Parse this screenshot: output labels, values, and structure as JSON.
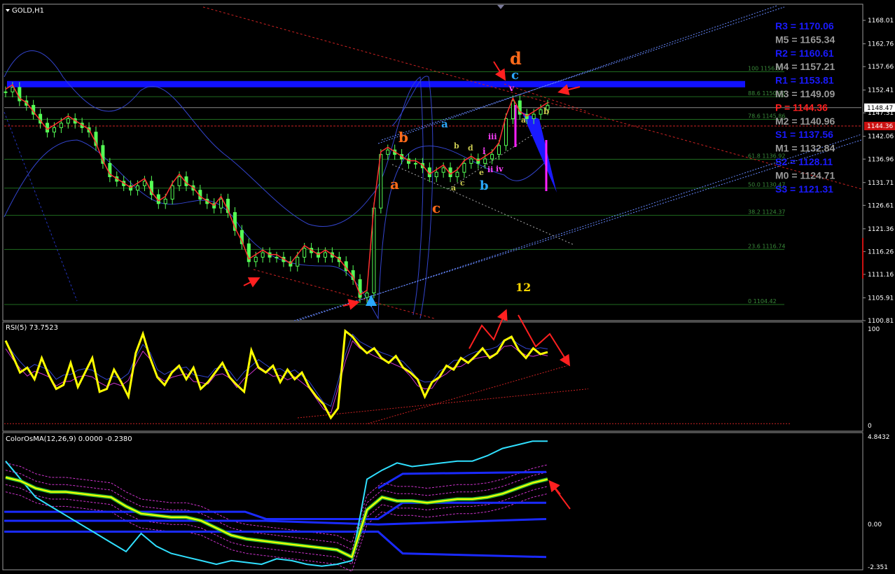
{
  "chart_data": [
    {
      "type": "candlestick",
      "title": "GOLD,H1",
      "ylim": [
        1100.81,
        1171.0
      ],
      "y_ticks": [
        "1168.01",
        "1162.76",
        "1157.66",
        "1152.41",
        "1147.31",
        "1142.06",
        "1136.96",
        "1131.71",
        "1126.61",
        "1121.36",
        "1116.26",
        "1111.16",
        "1105.91",
        "1100.81"
      ],
      "current_price_tag": "1148.47",
      "pivot_price_tag": "1144.36",
      "close_path": [
        1152,
        1153,
        1150,
        1149,
        1147,
        1145,
        1143,
        1144,
        1145,
        1146,
        1145,
        1144,
        1143,
        1140,
        1136,
        1133,
        1132,
        1131,
        1130,
        1131,
        1132,
        1129,
        1127,
        1128,
        1131,
        1133,
        1131,
        1130,
        1128,
        1127,
        1126,
        1128,
        1125,
        1121,
        1118,
        1114,
        1115,
        1116,
        1115,
        1115,
        1114,
        1113,
        1115,
        1117,
        1116,
        1115,
        1116,
        1115,
        1114,
        1112,
        1110,
        1106,
        1107,
        1126,
        1138,
        1139,
        1138,
        1137,
        1136,
        1136,
        1135,
        1133,
        1134,
        1135,
        1133,
        1134,
        1136,
        1137,
        1136,
        1137,
        1138,
        1140,
        1146,
        1150,
        1147,
        1146,
        1147,
        1148,
        1149
      ],
      "fib_levels": [
        {
          "label": "100 1156.51",
          "value": 1156.51
        },
        {
          "label": "88.6 1150.92",
          "value": 1150.92
        },
        {
          "label": "78.6 1145.86",
          "value": 1145.86
        },
        {
          "label": "61.8 1136.92",
          "value": 1136.92
        },
        {
          "label": "50.0 1130.47",
          "value": 1130.47
        },
        {
          "label": "38.2 1124.37",
          "value": 1124.37
        },
        {
          "label": "23.6 1116.74",
          "value": 1116.74
        },
        {
          "label": "0 1104.42",
          "value": 1104.42
        }
      ],
      "pivots": [
        {
          "name": "R3",
          "text": "R3 = 1170.06",
          "value": 1170.06,
          "color": "#1a1aff"
        },
        {
          "name": "M5",
          "text": "M5 = 1165.34",
          "value": 1165.34,
          "color": "#9a9a9a"
        },
        {
          "name": "R2",
          "text": "R2 = 1160.61",
          "value": 1160.61,
          "color": "#1a1aff"
        },
        {
          "name": "M4",
          "text": "M4 = 1157.21",
          "value": 1157.21,
          "color": "#9a9a9a"
        },
        {
          "name": "R1",
          "text": "R1 = 1153.81",
          "value": 1153.81,
          "color": "#1a1aff"
        },
        {
          "name": "M3",
          "text": "M3 = 1149.09",
          "value": 1149.09,
          "color": "#9a9a9a"
        },
        {
          "name": "P",
          "text": "P  = 1144.36",
          "value": 1144.36,
          "color": "#ff2020"
        },
        {
          "name": "M2",
          "text": "M2 = 1140.96",
          "value": 1140.96,
          "color": "#9a9a9a"
        },
        {
          "name": "S1",
          "text": "S1 = 1137.56",
          "value": 1137.56,
          "color": "#1a1aff"
        },
        {
          "name": "M1",
          "text": "M1 = 1132.84",
          "value": 1132.84,
          "color": "#9a9a9a"
        },
        {
          "name": "S2",
          "text": "S2 = 1128.11",
          "value": 1128.11,
          "color": "#1a1aff"
        },
        {
          "name": "M0",
          "text": "M0 = 1124.71",
          "value": 1124.71,
          "color": "#9a9a9a"
        },
        {
          "name": "S3",
          "text": "S3 = 1121.31",
          "value": 1121.31,
          "color": "#1a1aff"
        }
      ],
      "wave_labels": [
        {
          "text": "d",
          "color": "#ff6a1a"
        },
        {
          "text": "c",
          "color": "#2aa8ff"
        },
        {
          "text": "b",
          "color": "#ff6a1a"
        },
        {
          "text": "a",
          "color": "#ff6a1a"
        },
        {
          "text": "c",
          "color": "#ff6a1a"
        },
        {
          "text": "a",
          "color": "#2aa8ff"
        },
        {
          "text": "b",
          "color": "#2aa8ff"
        },
        {
          "text": "a",
          "color": "#c8c850"
        },
        {
          "text": "b",
          "color": "#c8c850"
        },
        {
          "text": "c",
          "color": "#c8c850"
        },
        {
          "text": "d",
          "color": "#c8c850"
        },
        {
          "text": "e",
          "color": "#c8c850"
        },
        {
          "text": "i",
          "color": "#ff40ff"
        },
        {
          "text": "ii",
          "color": "#ff40ff"
        },
        {
          "text": "iii",
          "color": "#ff40ff"
        },
        {
          "text": "iv",
          "color": "#ff40ff"
        },
        {
          "text": "v",
          "color": "#ff40ff"
        },
        {
          "text": "a",
          "color": "#c8c850"
        },
        {
          "text": "b",
          "color": "#c8c850"
        },
        {
          "text": "12",
          "color": "#ffd700"
        }
      ],
      "colors": {
        "candles": "#55ff55",
        "bands": "#3344cc",
        "pivot_band": "#1111ff",
        "trend": "#cc2222",
        "channel": "#6688ff",
        "up_arrow": "#2aa8ff",
        "arrow": "#ff2020"
      }
    },
    {
      "type": "line",
      "title": "RSI(5) 73.7523",
      "ylim": [
        0,
        100
      ],
      "y_ticks": [
        "100",
        "0"
      ],
      "series": [
        {
          "name": "RSI(5)",
          "color": "#ffff00",
          "values": [
            88,
            72,
            55,
            60,
            48,
            70,
            52,
            38,
            42,
            65,
            40,
            55,
            70,
            35,
            38,
            58,
            45,
            30,
            75,
            95,
            70,
            50,
            42,
            55,
            62,
            48,
            60,
            38,
            45,
            55,
            65,
            50,
            42,
            35,
            78,
            60,
            55,
            62,
            45,
            58,
            48,
            55,
            40,
            30,
            22,
            8,
            18,
            98,
            92,
            82,
            75,
            80,
            70,
            65,
            72,
            60,
            55,
            48,
            30,
            45,
            50,
            62,
            58,
            70,
            65,
            72,
            80,
            70,
            75,
            88,
            92,
            78,
            70,
            80,
            74,
            76
          ]
        }
      ]
    },
    {
      "type": "line",
      "title": "ColorOsMA(12,26,9) 0.0000 -0.2380",
      "ylim": [
        -2.351,
        4.8432
      ],
      "y_ticks": [
        "4.8432",
        "0.00",
        "-2.351"
      ],
      "series": [
        {
          "name": "OsMA",
          "color": "#ffff00",
          "values": [
            2.6,
            2.4,
            2.0,
            1.8,
            1.8,
            1.7,
            1.6,
            1.5,
            1.0,
            0.6,
            0.5,
            0.4,
            0.4,
            0.2,
            -0.2,
            -0.6,
            -0.8,
            -0.9,
            -1.0,
            -1.1,
            -1.2,
            -1.3,
            -1.4,
            -1.8,
            0.8,
            1.5,
            1.3,
            1.3,
            1.2,
            1.3,
            1.4,
            1.4,
            1.5,
            1.7,
            2.0,
            2.3,
            2.5
          ]
        },
        {
          "name": "Upper",
          "color": "#30e0ff",
          "values": [
            3.5,
            2.5,
            1.5,
            1.0,
            0.5,
            0.0,
            -0.5,
            -1.0,
            -1.5,
            -0.5,
            -1.2,
            -1.6,
            -1.8,
            -2.0,
            -2.2,
            -2.0,
            -2.1,
            -2.2,
            -1.9,
            -2.0,
            -2.2,
            -2.3,
            -2.2,
            -2.0,
            2.5,
            3.0,
            3.4,
            3.2,
            3.3,
            3.4,
            3.5,
            3.5,
            3.8,
            4.2,
            4.4,
            4.6,
            4.6
          ]
        }
      ]
    }
  ]
}
